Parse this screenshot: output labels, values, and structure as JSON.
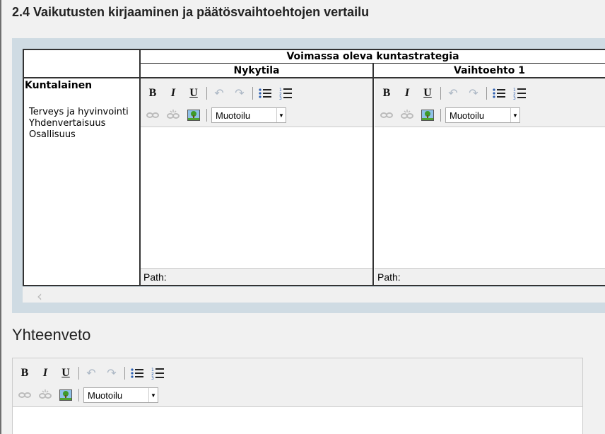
{
  "section": {
    "title": "2.4 Vaikutusten kirjaaminen ja päätösvaihtoehtojen vertailu"
  },
  "table": {
    "group_header": "Voimassa oleva kuntastrategia",
    "col_headers": [
      "Nykytila",
      "Vaihtoehto 1"
    ],
    "row_label": "Kuntalainen",
    "row_items": [
      "Terveys ja hyvinvointi",
      "Yhdenvertaisuus",
      "Osallisuus"
    ]
  },
  "editor": {
    "bold": "B",
    "italic": "I",
    "underline": "U",
    "undo_icon": "undo-icon",
    "redo_icon": "redo-icon",
    "bullet_icon": "bullet-list-icon",
    "numbered_icon": "numbered-list-icon",
    "link_icon": "link-icon",
    "unlink_icon": "unlink-icon",
    "image_icon": "image-icon",
    "format_select": "Muotoilu",
    "path_label": "Path:"
  },
  "summary": {
    "title": "Yhteenveto"
  }
}
